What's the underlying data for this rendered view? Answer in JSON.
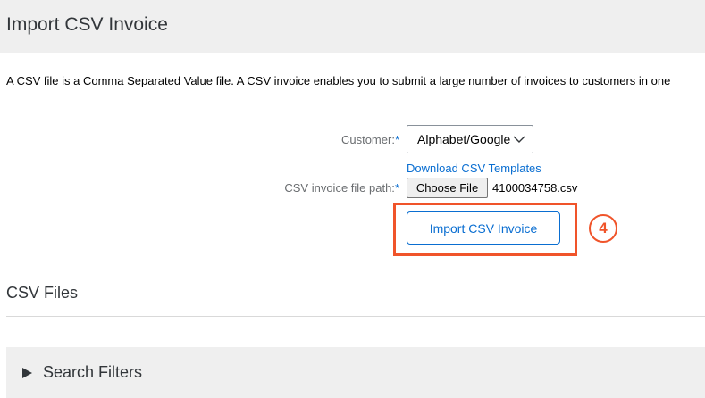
{
  "header": {
    "title": "Import CSV Invoice"
  },
  "description": "A CSV file is a Comma Separated Value file. A CSV invoice enables you to submit a large number of invoices to customers in one",
  "form": {
    "customer_label": "Customer:",
    "required_marker": "*",
    "customer_value": "Alphabet/Google",
    "download_link": "Download CSV Templates",
    "file_path_label": "CSV invoice file path:",
    "choose_file_label": "Choose File",
    "file_name": "4100034758.csv",
    "import_button_label": "Import CSV Invoice"
  },
  "annotation": {
    "step_number": "4",
    "color": "#f0542a"
  },
  "csv_files": {
    "section_title": "CSV Files",
    "search_filters_label": "Search Filters"
  },
  "colors": {
    "accent": "#0a6ed1",
    "header_bg": "#efefef",
    "highlight": "#f0542a"
  },
  "icons": {
    "select_chevron": "chevron-down-icon",
    "filters_toggle": "caret-right-icon"
  }
}
